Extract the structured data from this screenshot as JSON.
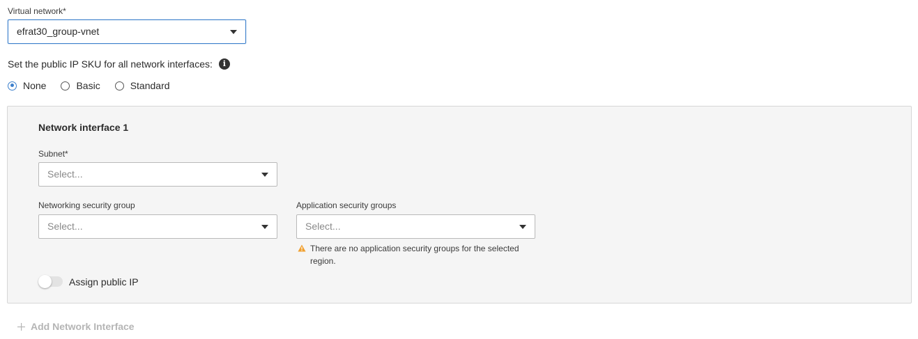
{
  "virtual_network": {
    "label": "Virtual network*",
    "value": "efrat30_group-vnet"
  },
  "public_ip_sku": {
    "label": "Set the public IP SKU for all network interfaces:",
    "options": [
      {
        "label": "None",
        "checked": true
      },
      {
        "label": "Basic",
        "checked": false
      },
      {
        "label": "Standard",
        "checked": false
      }
    ]
  },
  "network_interface": {
    "title": "Network interface 1",
    "subnet": {
      "label": "Subnet*",
      "placeholder": "Select..."
    },
    "nsg": {
      "label": "Networking security group",
      "placeholder": "Select..."
    },
    "asg": {
      "label": "Application security groups",
      "placeholder": "Select...",
      "warning_line1": "There are no application security groups for the selected",
      "warning_line2": "region."
    },
    "assign_public_ip": {
      "label": "Assign public IP",
      "enabled": false
    }
  },
  "add_interface": {
    "label": "Add Network Interface",
    "icon": "plus-icon"
  },
  "colors": {
    "accent": "#3b7fcc",
    "warning": "#f0a030",
    "panel_bg": "#f5f5f5",
    "disabled_text": "#b5b5b5"
  }
}
